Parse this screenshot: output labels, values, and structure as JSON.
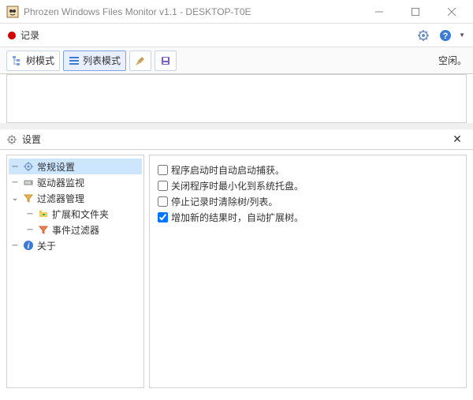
{
  "window": {
    "title": "Phrozen Windows Files Monitor v1.1 - DESKTOP-T0E"
  },
  "recordbar": {
    "label": "记录"
  },
  "toolbar": {
    "tree_mode": "树模式",
    "list_mode": "列表模式",
    "status": "空闲。"
  },
  "settings": {
    "title": "设置",
    "tree": {
      "general": "常规设置",
      "drive_monitor": "驱动器监视",
      "filter_manager": "过滤器管理",
      "ext_folders": "扩展和文件夹",
      "event_filter": "事件过滤器",
      "about": "关于"
    },
    "options": [
      {
        "label": "程序启动时自动启动捕获。",
        "checked": false
      },
      {
        "label": "关闭程序时最小化到系统托盘。",
        "checked": false
      },
      {
        "label": "停止记录时清除树/列表。",
        "checked": false
      },
      {
        "label": "增加新的结果时，自动扩展树。",
        "checked": true
      }
    ]
  }
}
